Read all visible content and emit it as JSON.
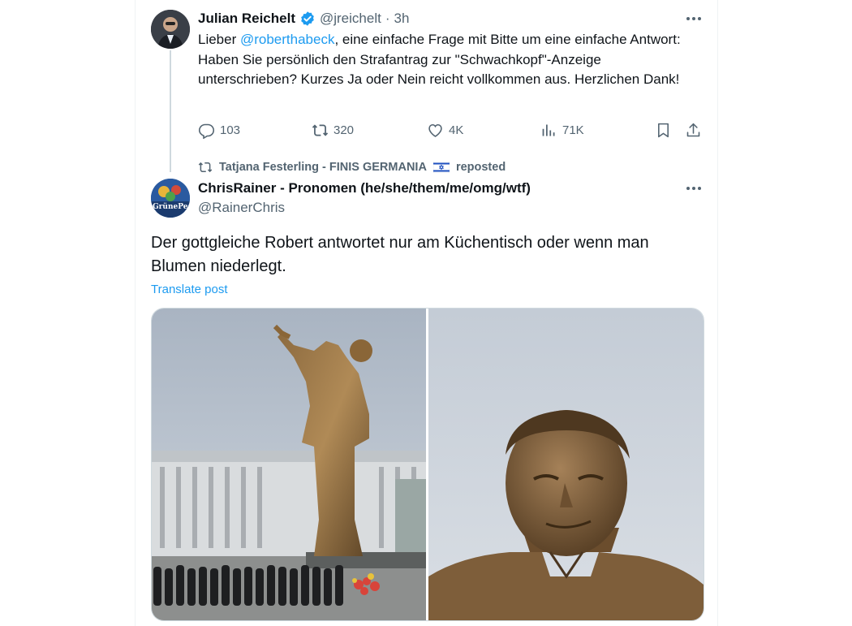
{
  "tweet1": {
    "author_name": "Julian Reichelt",
    "handle": "@jreichelt",
    "separator": "·",
    "time": "3h",
    "text_prefix": "Lieber ",
    "mention": "@roberthabeck",
    "text_suffix": ", eine einfache Frage mit Bitte um eine einfache Antwort: Haben Sie persönlich den Strafantrag zur \"Schwachkopf\"-Anzeige unterschrieben? Kurzes Ja oder Nein reicht vollkommen aus. Herzlichen Dank!",
    "replies": "103",
    "reposts": "320",
    "likes": "4K",
    "views": "71K"
  },
  "repost_banner": {
    "reposter": "Tatjana Festerling - FINIS GERMANIA",
    "label": "reposted"
  },
  "tweet2": {
    "author_name": "ChrisRainer - Pronomen (he/she/them/me/omg/wtf)",
    "handle": "@RainerChris",
    "avatar_text": "GrünePest",
    "text": "Der gottgleiche Robert antwortet nur am Küchentisch oder wenn man Blumen niederlegt.",
    "translate": "Translate post"
  },
  "colors": {
    "accent": "#1d9bf0",
    "muted": "#536471",
    "text": "#0f1419",
    "border": "#eff3f4"
  }
}
